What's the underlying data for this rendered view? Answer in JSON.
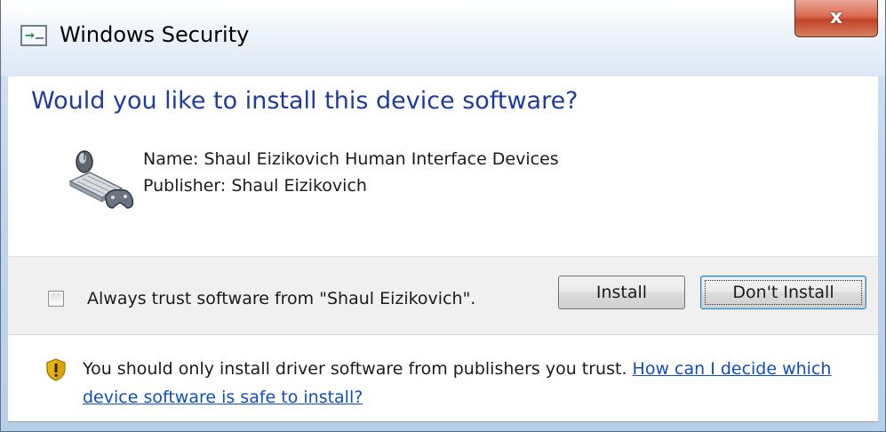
{
  "window": {
    "title": "Windows Security",
    "close_label": "x"
  },
  "content": {
    "heading": "Would you like to install this device software?",
    "name_line": "Name: Shaul Eizikovich Human Interface Devices",
    "publisher_line": "Publisher: Shaul Eizikovich"
  },
  "options": {
    "trust_checkbox_checked": false,
    "trust_label": "Always trust software from \"Shaul Eizikovich\".",
    "install_label": "Install",
    "dont_install_label": "Don't Install"
  },
  "warning": {
    "text": "You should only install driver software from publishers you trust.",
    "link_text": "How can I decide which device software is safe to install?"
  },
  "icons": {
    "app_icon": "window-security-icon",
    "device_icon": "human-interface-device-icon",
    "warning_icon": "security-shield-icon"
  },
  "colors": {
    "heading": "#1e3d9b",
    "link": "#0f4fbf",
    "close_button": "#c2432a"
  }
}
